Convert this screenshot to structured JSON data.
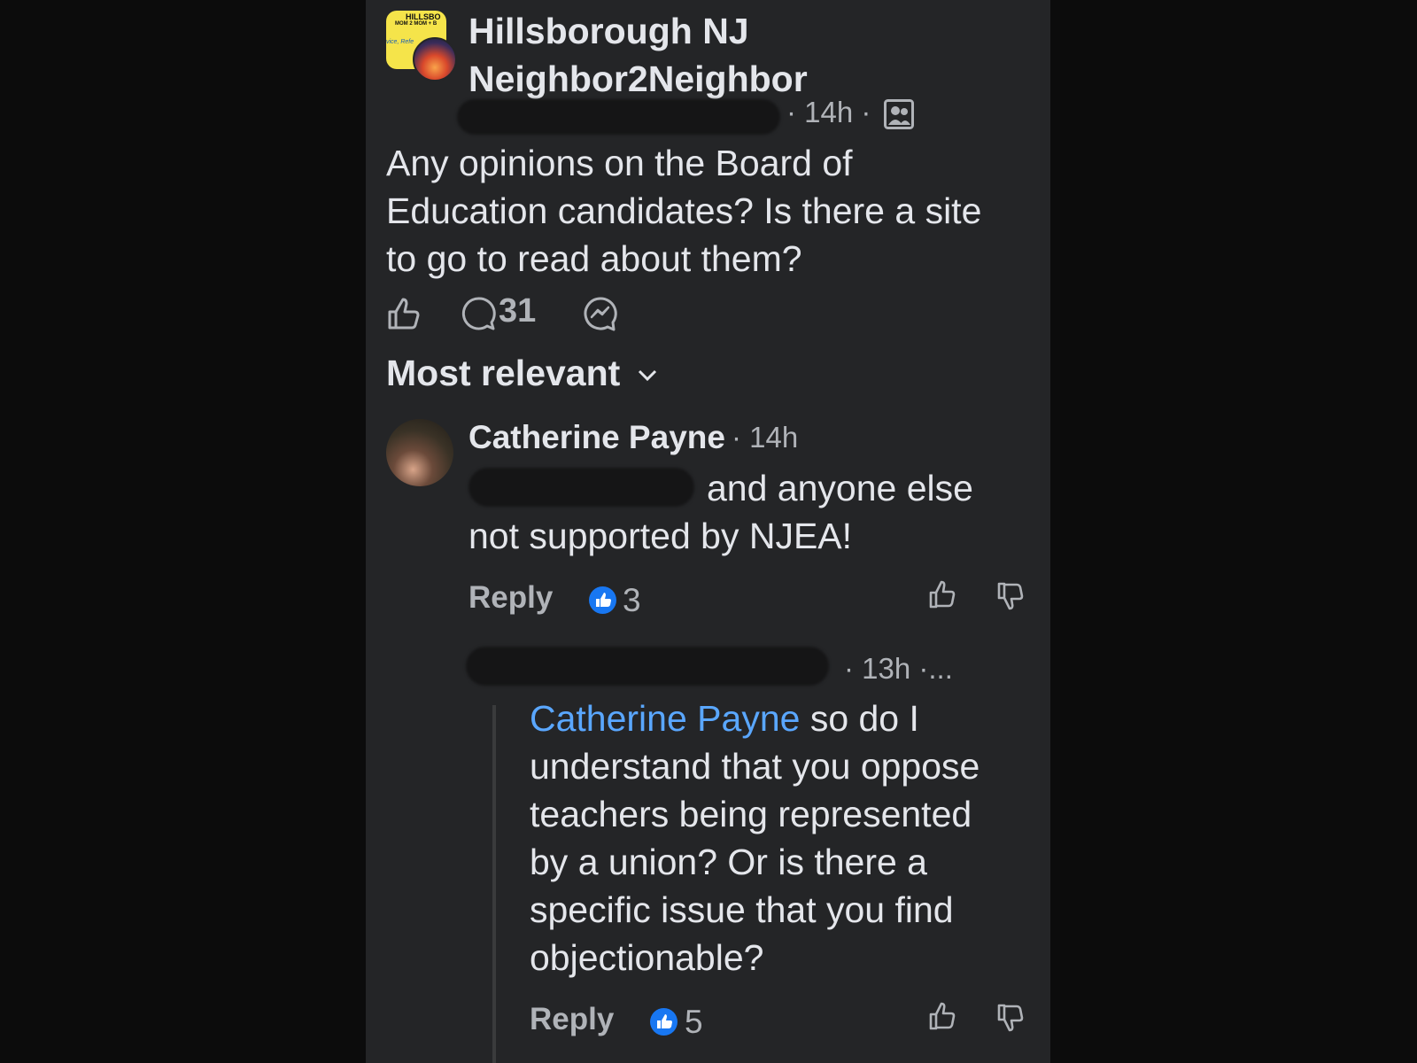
{
  "post": {
    "group_name_line1": "Hillsborough NJ",
    "group_name_line2": "Neighbor2Neighbor",
    "time": "· 14h ·",
    "text_line1": "Any opinions on the Board of",
    "text_line2": "Education candidates? Is there a site",
    "text_line3": "to go to read about them?",
    "comment_count": "31",
    "group_avatar_text": [
      "HILLSBO",
      "MOM 2 MOM + B",
      "vice, Refe"
    ]
  },
  "sort": {
    "label": "Most relevant",
    "icon": "chevron-down-icon"
  },
  "comments": [
    {
      "author": "Catherine Payne",
      "time": "· 14h",
      "text_line1": "and anyone else",
      "text_line2": "not supported by NJEA!",
      "reply_label": "Reply",
      "likes": "3"
    },
    {
      "time": "· 13h ·...",
      "mention": "Catherine Payne",
      "text_line1": " so do I",
      "text_line2": "understand that you oppose",
      "text_line3": "teachers being represented",
      "text_line4": "by a union? Or is there a",
      "text_line5": "specific issue that you find",
      "text_line6": "objectionable?",
      "reply_label": "Reply",
      "likes": "5"
    }
  ],
  "colors": {
    "background": "#242527",
    "accent": "#1877f2",
    "mention": "#5aa7ff"
  }
}
